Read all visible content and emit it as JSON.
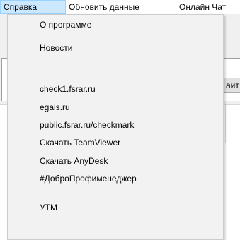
{
  "menubar": {
    "items": [
      {
        "label": "Справка"
      },
      {
        "label": "Обновить данные"
      },
      {
        "label": "Онлайн Чат"
      }
    ]
  },
  "background": {
    "tab_label": "айт"
  },
  "help_menu": {
    "groups": [
      [
        "О программе"
      ],
      [
        "Новости"
      ],
      [
        "check1.fsrar.ru",
        "egais.ru",
        "public.fsrar.ru/checkmark",
        "Скачать TeamViewer",
        "Скачать AnyDesk",
        "#ДоброПрофименеджер"
      ],
      [
        "УТМ"
      ]
    ]
  }
}
